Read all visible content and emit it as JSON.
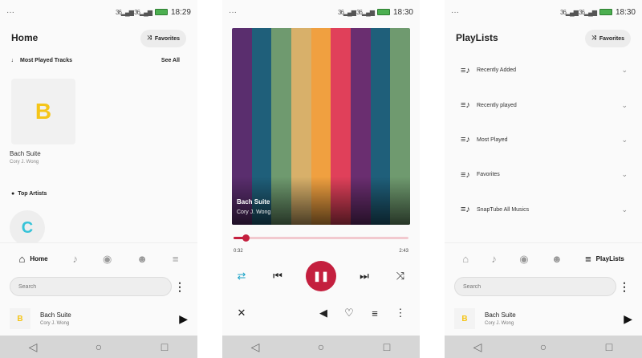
{
  "status_left": "···",
  "signal_text": "36▂▄▆ 36▂▄▆",
  "screen1": {
    "time": "18:29",
    "title": "Home",
    "favorites_label": "Favorites",
    "most_played_label": "Most Played Tracks",
    "see_all": "See All",
    "album": {
      "letter": "B",
      "title": "Bach Suite",
      "artist": "Cory J. Wong"
    },
    "top_artists_label": "Top Artists",
    "artist_letter": "C",
    "tabs": [
      {
        "label": "Home",
        "icon": "home-icon",
        "active": true
      },
      {
        "label": "",
        "icon": "music-note-icon"
      },
      {
        "label": "",
        "icon": "album-icon"
      },
      {
        "label": "",
        "icon": "person-icon"
      },
      {
        "label": "",
        "icon": "playlist-icon"
      }
    ],
    "search_placeholder": "Search",
    "mini": {
      "letter": "B",
      "title": "Bach Suite",
      "artist": "Cory J. Wong"
    }
  },
  "screen2": {
    "time": "18:30",
    "cover_title": "Bach Suite",
    "cover_artist": "Cory J. Wong",
    "stripe_colors": [
      "#5a2e6e",
      "#1f5f7a",
      "#6f9a6f",
      "#d8b06a",
      "#f0a040",
      "#e0405a",
      "#6a2e70",
      "#1f5f7a",
      "#6f9a6f"
    ],
    "progress": 0.07,
    "time_current": "0:32",
    "time_total": "2:43",
    "accent": "#c41f3e",
    "repeat_color": "#1aa3c7"
  },
  "screen3": {
    "time": "18:30",
    "title": "PlayLists",
    "favorites_label": "Favorites",
    "playlists": [
      {
        "label": "Recently Added"
      },
      {
        "label": "Recently played"
      },
      {
        "label": "Most Played"
      },
      {
        "label": "Favorites"
      },
      {
        "label": "SnapTube All Musics"
      }
    ],
    "tabs": [
      {
        "label": "",
        "icon": "home-icon"
      },
      {
        "label": "",
        "icon": "music-note-icon"
      },
      {
        "label": "",
        "icon": "album-icon"
      },
      {
        "label": "",
        "icon": "person-icon"
      },
      {
        "label": "PlayLists",
        "icon": "playlist-icon",
        "active": true
      }
    ],
    "search_placeholder": "Search",
    "mini": {
      "letter": "B",
      "title": "Bach Suite",
      "artist": "Cory J. Wong"
    }
  }
}
